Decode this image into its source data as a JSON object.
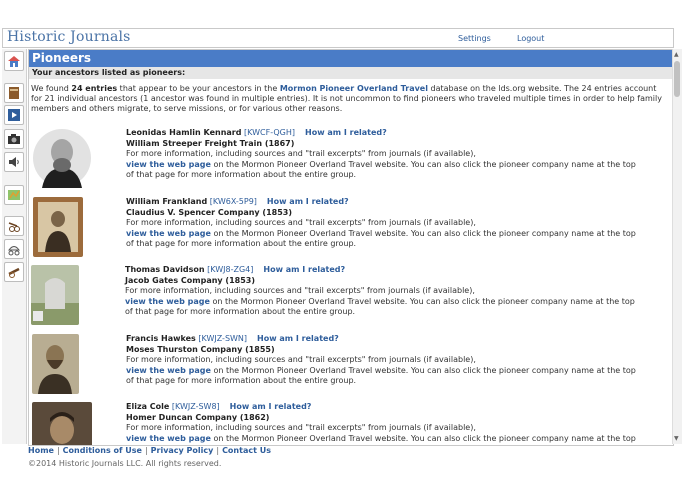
{
  "header": {
    "brand": "Historic Journals",
    "settings_label": "Settings",
    "logout_label": "Logout"
  },
  "sidebar": {
    "items": [
      {
        "icon": "home-icon"
      },
      {
        "icon": "book-icon"
      },
      {
        "icon": "play-icon"
      },
      {
        "icon": "camera-icon"
      },
      {
        "icon": "speaker-icon"
      },
      {
        "icon": "map-icon"
      },
      {
        "icon": "handcart-icon"
      },
      {
        "icon": "wagon-icon"
      },
      {
        "icon": "cannon-icon"
      }
    ]
  },
  "main": {
    "title": "Pioneers",
    "subtitle": "Your ancestors listed as pioneers:",
    "intro": {
      "prefix": "We found ",
      "count": "24 entries",
      "middle": " that appear to be your ancestors in the ",
      "db": "Mormon Pioneer Overland Travel",
      "suffix": " database on the lds.org website. The 24 entries account for 21 individual ancestors (1 ancestor was found in multiple entries). It is not uncommon to find pioneers who traveled multiple times in order to help family members and others migrate, to serve missions, or for various other reasons."
    },
    "more_info_prefix": "For more information, including sources and \"trail excerpts\" from journals (if available),",
    "web_link": "view the web page",
    "more_info_suffix": " on the Mormon Pioneer Overland Travel website. You can also click the pioneer company name at the top of that page for more information about the entire group.",
    "how_related": "How am I related?",
    "entries": [
      {
        "name": "Leonidas Hamlin Kennard",
        "pid": "[KWCF-QGH]",
        "company": "William Streeper Freight Train (1867)"
      },
      {
        "name": "William Frankland",
        "pid": "[KW6X-5P9]",
        "company": "Claudius V. Spencer Company (1853)"
      },
      {
        "name": "Thomas Davidson",
        "pid": "[KWJ8-ZG4]",
        "company": "Jacob Gates Company (1853)"
      },
      {
        "name": "Francis Hawkes",
        "pid": "[KWJZ-SWN]",
        "company": "Moses Thurston Company (1855)"
      },
      {
        "name": "Eliza Cole",
        "pid": "[KWJZ-SW8]",
        "company": "Homer Duncan Company (1862)"
      }
    ]
  },
  "footer": {
    "home": "Home",
    "conditions": "Conditions of Use",
    "privacy": "Privacy Policy",
    "contact": "Contact Us",
    "copyright": "©2014 Historic Journals LLC.   All rights reserved."
  }
}
